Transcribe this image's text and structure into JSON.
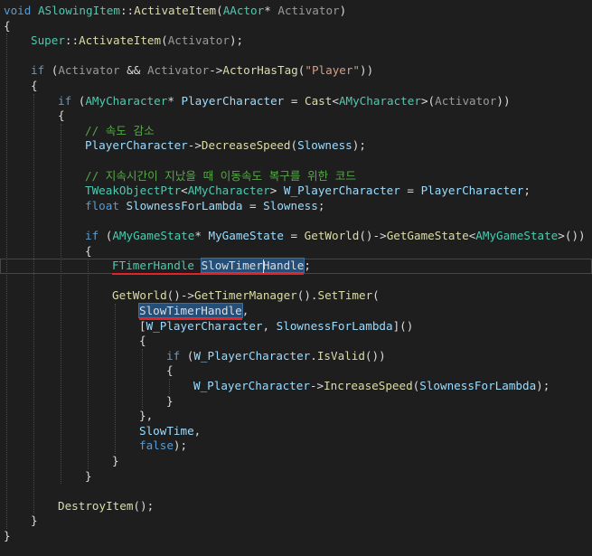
{
  "editor": {
    "lines": [
      {
        "indent": 0,
        "tokens": [
          [
            "kw",
            "void"
          ],
          [
            "pl",
            " "
          ],
          [
            "ty",
            "ASlowingItem"
          ],
          [
            "pl",
            "::"
          ],
          [
            "fn",
            "ActivateItem"
          ],
          [
            "pl",
            "("
          ],
          [
            "ty",
            "AActor"
          ],
          [
            "pl",
            "* "
          ],
          [
            "pm",
            "Activator"
          ],
          [
            "pl",
            ")"
          ]
        ]
      },
      {
        "indent": 0,
        "tokens": [
          [
            "pl",
            "{"
          ]
        ]
      },
      {
        "indent": 1,
        "tokens": [
          [
            "ty",
            "Super"
          ],
          [
            "pl",
            "::"
          ],
          [
            "fn",
            "ActivateItem"
          ],
          [
            "pl",
            "("
          ],
          [
            "pm",
            "Activator"
          ],
          [
            "pl",
            ");"
          ]
        ]
      },
      {
        "indent": 0,
        "tokens": []
      },
      {
        "indent": 1,
        "tokens": [
          [
            "kw",
            "if"
          ],
          [
            "pl",
            " ("
          ],
          [
            "pm",
            "Activator"
          ],
          [
            "pl",
            " && "
          ],
          [
            "pm",
            "Activator"
          ],
          [
            "pl",
            "->"
          ],
          [
            "fn",
            "ActorHasTag"
          ],
          [
            "pl",
            "("
          ],
          [
            "str",
            "\"Player\""
          ],
          [
            "pl",
            "))"
          ]
        ]
      },
      {
        "indent": 1,
        "tokens": [
          [
            "pl",
            "{"
          ]
        ]
      },
      {
        "indent": 2,
        "tokens": [
          [
            "kw",
            "if"
          ],
          [
            "pl",
            " ("
          ],
          [
            "ty",
            "AMyCharacter"
          ],
          [
            "pl",
            "* "
          ],
          [
            "vr",
            "PlayerCharacter"
          ],
          [
            "pl",
            " = "
          ],
          [
            "fn",
            "Cast"
          ],
          [
            "pl",
            "<"
          ],
          [
            "ty",
            "AMyCharacter"
          ],
          [
            "pl",
            ">("
          ],
          [
            "pm",
            "Activator"
          ],
          [
            "pl",
            "))"
          ]
        ]
      },
      {
        "indent": 2,
        "tokens": [
          [
            "pl",
            "{"
          ]
        ]
      },
      {
        "indent": 3,
        "tokens": [
          [
            "cm",
            "// 속도 감소"
          ]
        ]
      },
      {
        "indent": 3,
        "tokens": [
          [
            "vr",
            "PlayerCharacter"
          ],
          [
            "pl",
            "->"
          ],
          [
            "fn",
            "DecreaseSpeed"
          ],
          [
            "pl",
            "("
          ],
          [
            "vr",
            "Slowness"
          ],
          [
            "pl",
            ");"
          ]
        ]
      },
      {
        "indent": 0,
        "tokens": []
      },
      {
        "indent": 3,
        "tokens": [
          [
            "cm",
            "// 지속시간이 지났을 때 이동속도 복구를 위한 코드"
          ]
        ]
      },
      {
        "indent": 3,
        "tokens": [
          [
            "ty",
            "TWeakObjectPtr"
          ],
          [
            "pl",
            "<"
          ],
          [
            "ty",
            "AMyCharacter"
          ],
          [
            "pl",
            "> "
          ],
          [
            "vr",
            "W_PlayerCharacter"
          ],
          [
            "pl",
            " = "
          ],
          [
            "vr",
            "PlayerCharacter"
          ],
          [
            "pl",
            ";"
          ]
        ]
      },
      {
        "indent": 3,
        "tokens": [
          [
            "kw",
            "float"
          ],
          [
            "pl",
            " "
          ],
          [
            "vr",
            "SlownessForLambda"
          ],
          [
            "pl",
            " = "
          ],
          [
            "vr",
            "Slowness"
          ],
          [
            "pl",
            ";"
          ]
        ]
      },
      {
        "indent": 0,
        "tokens": []
      },
      {
        "indent": 3,
        "tokens": [
          [
            "kw",
            "if"
          ],
          [
            "pl",
            " ("
          ],
          [
            "ty",
            "AMyGameState"
          ],
          [
            "pl",
            "* "
          ],
          [
            "vr",
            "MyGameState"
          ],
          [
            "pl",
            " = "
          ],
          [
            "fn",
            "GetWorld"
          ],
          [
            "pl",
            "()->"
          ],
          [
            "fn",
            "GetGameState"
          ],
          [
            "pl",
            "<"
          ],
          [
            "ty",
            "AMyGameState"
          ],
          [
            "pl",
            ">())"
          ]
        ]
      },
      {
        "indent": 3,
        "tokens": [
          [
            "pl",
            "{"
          ]
        ]
      },
      {
        "indent": 4,
        "tokens": [
          [
            "ty",
            "FTimerHandle"
          ],
          [
            "pl",
            " "
          ],
          [
            "hl",
            "SlowTimerHandle"
          ],
          [
            "pl",
            ";"
          ]
        ]
      },
      {
        "indent": 0,
        "tokens": []
      },
      {
        "indent": 4,
        "tokens": [
          [
            "fn",
            "GetWorld"
          ],
          [
            "pl",
            "()->"
          ],
          [
            "fn",
            "GetTimerManager"
          ],
          [
            "pl",
            "()."
          ],
          [
            "fn",
            "SetTimer"
          ],
          [
            "pl",
            "("
          ]
        ]
      },
      {
        "indent": 5,
        "tokens": [
          [
            "hl",
            "SlowTimerHandle"
          ],
          [
            "pl",
            ","
          ]
        ]
      },
      {
        "indent": 5,
        "tokens": [
          [
            "pl",
            "["
          ],
          [
            "vr",
            "W_PlayerCharacter"
          ],
          [
            "pl",
            ", "
          ],
          [
            "vr",
            "SlownessForLambda"
          ],
          [
            "pl",
            "]()"
          ]
        ]
      },
      {
        "indent": 5,
        "tokens": [
          [
            "pl",
            "{"
          ]
        ]
      },
      {
        "indent": 6,
        "tokens": [
          [
            "kw",
            "if"
          ],
          [
            "pl",
            " ("
          ],
          [
            "vr",
            "W_PlayerCharacter"
          ],
          [
            "pl",
            "."
          ],
          [
            "fn",
            "IsValid"
          ],
          [
            "pl",
            "())"
          ]
        ]
      },
      {
        "indent": 6,
        "tokens": [
          [
            "pl",
            "{"
          ]
        ]
      },
      {
        "indent": 7,
        "tokens": [
          [
            "vr",
            "W_PlayerCharacter"
          ],
          [
            "pl",
            "->"
          ],
          [
            "fn",
            "IncreaseSpeed"
          ],
          [
            "pl",
            "("
          ],
          [
            "vr",
            "SlownessForLambda"
          ],
          [
            "pl",
            ");"
          ]
        ]
      },
      {
        "indent": 6,
        "tokens": [
          [
            "pl",
            "}"
          ]
        ]
      },
      {
        "indent": 5,
        "tokens": [
          [
            "pl",
            "},"
          ]
        ]
      },
      {
        "indent": 5,
        "tokens": [
          [
            "vr",
            "SlowTime"
          ],
          [
            "pl",
            ","
          ]
        ]
      },
      {
        "indent": 5,
        "tokens": [
          [
            "kw",
            "false"
          ],
          [
            "pl",
            ");"
          ]
        ]
      },
      {
        "indent": 4,
        "tokens": [
          [
            "pl",
            "}"
          ]
        ]
      },
      {
        "indent": 3,
        "tokens": [
          [
            "pl",
            "}"
          ]
        ]
      },
      {
        "indent": 0,
        "tokens": []
      },
      {
        "indent": 2,
        "tokens": [
          [
            "fn",
            "DestroyItem"
          ],
          [
            "pl",
            "();"
          ]
        ]
      },
      {
        "indent": 1,
        "tokens": [
          [
            "pl",
            "}"
          ]
        ]
      },
      {
        "indent": 0,
        "tokens": [
          [
            "pl",
            "}"
          ]
        ]
      }
    ],
    "current_line_index": 17,
    "annotations": {
      "underlined_lines": [
        17,
        20
      ],
      "underline_color": "#e0222b"
    }
  }
}
